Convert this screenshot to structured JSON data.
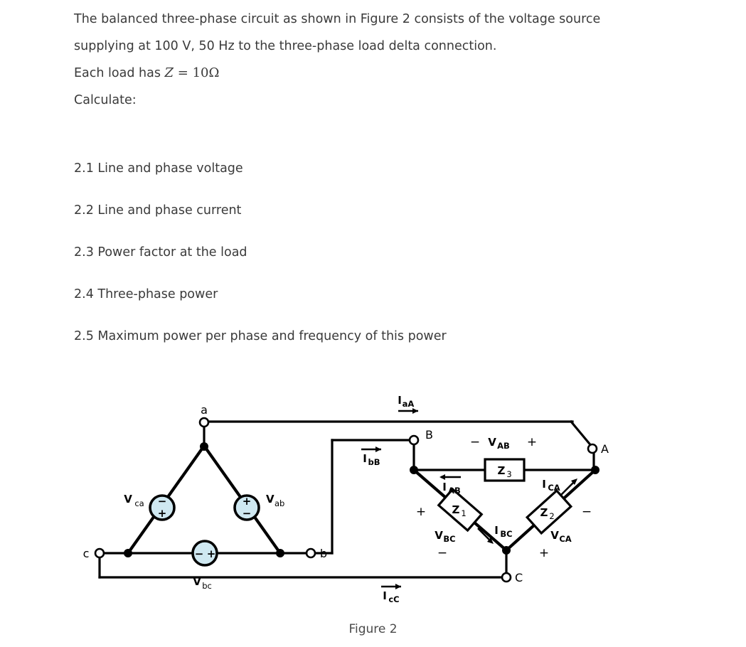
{
  "document": {
    "paragraphs": [
      "The balanced three-phase circuit as shown in Figure 2 consists of the voltage source supplying at 100 V, 50 Hz to the three-phase load delta connection.",
      "Each load has Z = 10 Ω",
      "Calculate:"
    ],
    "intro_line1": "The balanced three-phase circuit as shown in Figure 2 consists of the voltage source",
    "intro_line2": "supplying at 100 V, 50 Hz to the three-phase load delta connection.",
    "load_line_prefix": "Each load has ",
    "load_symbol_z": "Z",
    "load_equals": " = ",
    "load_value": "10",
    "load_unit": "Ω",
    "calculate_label": "Calculate:",
    "questions": [
      "2.1 Line and phase voltage",
      "2.2 Line and phase current",
      "2.3 Power factor at the load",
      "2.4 Three-phase power",
      "2.5 Maximum power per phase and frequency of this power"
    ]
  },
  "figure": {
    "caption": "Figure 2",
    "source": {
      "terminals": [
        {
          "id": "a",
          "label": "a"
        },
        {
          "id": "b",
          "label": "b"
        },
        {
          "id": "c",
          "label": "c"
        }
      ],
      "sources": [
        {
          "id": "vca",
          "label": "V",
          "subscript": "ca",
          "top_sign": "−",
          "bottom_sign": "+"
        },
        {
          "id": "vab",
          "label": "V",
          "subscript": "ab",
          "top_sign": "+",
          "bottom_sign": "−"
        },
        {
          "id": "vbc",
          "label": "V",
          "subscript": "bc",
          "left_sign": "−",
          "right_sign": "+"
        }
      ]
    },
    "load": {
      "terminals": [
        {
          "id": "A",
          "label": "A"
        },
        {
          "id": "B",
          "label": "B"
        },
        {
          "id": "C",
          "label": "C"
        }
      ],
      "impedances": [
        {
          "id": "z3",
          "label": "Z",
          "subscript": "3"
        },
        {
          "id": "z1",
          "label": "Z",
          "subscript": "1"
        },
        {
          "id": "z2",
          "label": "Z",
          "subscript": "2"
        }
      ],
      "voltages": [
        {
          "id": "vab",
          "label": "V",
          "subscript": "AB",
          "minus": "−",
          "plus": "+"
        },
        {
          "id": "vbc",
          "label": "V",
          "subscript": "BC",
          "plus": "+",
          "minus": "−"
        },
        {
          "id": "vca",
          "label": "V",
          "subscript": "CA",
          "minus": "−",
          "plus": "+"
        }
      ],
      "phase_currents": [
        {
          "id": "iab",
          "label": "I",
          "subscript": "AB"
        },
        {
          "id": "ibc",
          "label": "I",
          "subscript": "BC"
        },
        {
          "id": "ica",
          "label": "I",
          "subscript": "CA"
        }
      ]
    },
    "line_currents": [
      {
        "id": "iaa",
        "label": "I",
        "subscript": "aA"
      },
      {
        "id": "ibb",
        "label": "I",
        "subscript": "bB"
      },
      {
        "id": "icc",
        "label": "I",
        "subscript": "cC"
      }
    ],
    "colors": {
      "source_fill": "#cfe8f1",
      "wire": "#000000",
      "text": "#3a3a3a",
      "background": "#ffffff"
    }
  }
}
